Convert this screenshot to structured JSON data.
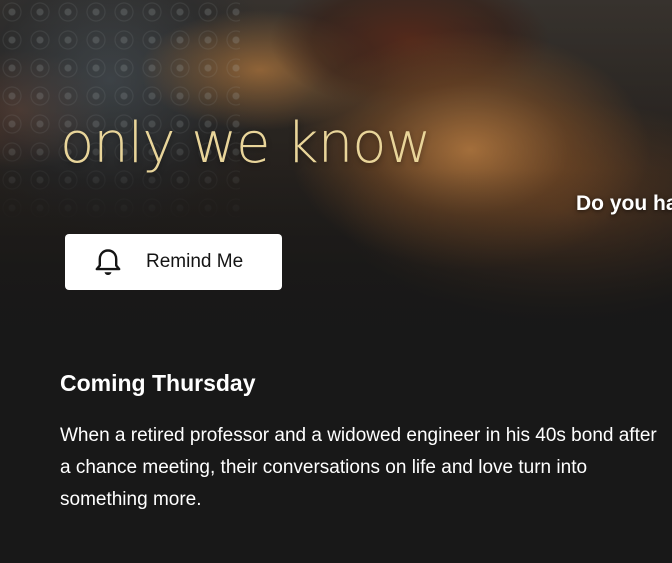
{
  "hero": {
    "title_logo": "only we know",
    "tagline": "Do you ha",
    "remind_button": {
      "label": "Remind Me",
      "icon": "bell-icon"
    }
  },
  "details": {
    "release": "Coming Thursday",
    "synopsis": "When a retired professor and a widowed engineer in his 40s bond after a chance meeting, their conversations on life and love turn into something more."
  },
  "colors": {
    "background": "#181818",
    "title_gold": "#e9d59a",
    "button_bg": "#ffffff",
    "text": "#ffffff"
  }
}
